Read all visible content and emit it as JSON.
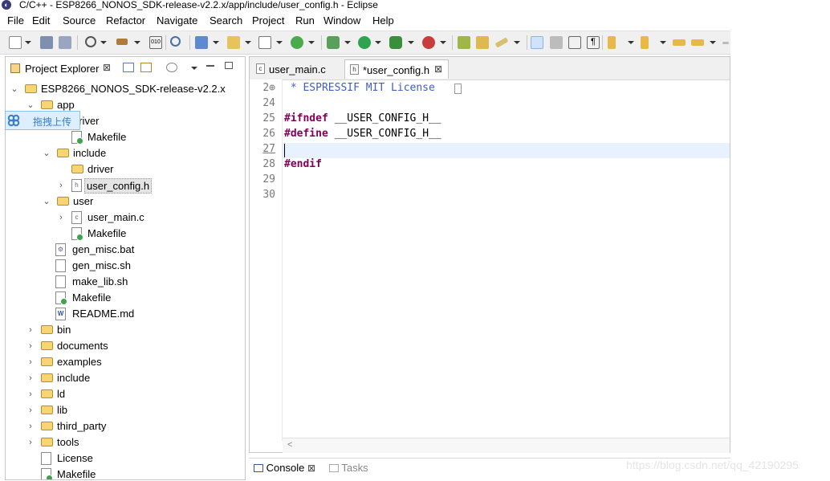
{
  "window": {
    "title": "C/C++ - ESP8266_NONOS_SDK-release-v2.2.x/app/include/user_config.h - Eclipse"
  },
  "menu": [
    "File",
    "Edit",
    "Source",
    "Refactor",
    "Navigate",
    "Search",
    "Project",
    "Run",
    "Window",
    "Help"
  ],
  "project_explorer": {
    "tab_label": "Project Explorer",
    "close_glyph": "⊠",
    "tree": [
      {
        "label": "ESP8266_NONOS_SDK-release-v2.2.x",
        "icon": "project-icon",
        "expanded": true
      },
      {
        "label": "app",
        "icon": "folder-icon",
        "expanded": true
      },
      {
        "label": "driver",
        "icon": "folder-icon",
        "expanded": true
      },
      {
        "label": "Makefile",
        "icon": "makefile-icon"
      },
      {
        "label": "include",
        "icon": "folder-icon",
        "expanded": true
      },
      {
        "label": "driver",
        "icon": "folder-icon"
      },
      {
        "label": "user_config.h",
        "icon": "header-file-icon",
        "selected": true
      },
      {
        "label": "user",
        "icon": "folder-icon",
        "expanded": true
      },
      {
        "label": "user_main.c",
        "icon": "c-file-icon"
      },
      {
        "label": "Makefile",
        "icon": "makefile-icon"
      },
      {
        "label": "gen_misc.bat",
        "icon": "bat-file-icon"
      },
      {
        "label": "gen_misc.sh",
        "icon": "text-file-icon"
      },
      {
        "label": "make_lib.sh",
        "icon": "text-file-icon"
      },
      {
        "label": "Makefile",
        "icon": "makefile-icon"
      },
      {
        "label": "README.md",
        "icon": "word-file-icon"
      },
      {
        "label": "bin",
        "icon": "folder-icon"
      },
      {
        "label": "documents",
        "icon": "folder-icon"
      },
      {
        "label": "examples",
        "icon": "folder-icon"
      },
      {
        "label": "include",
        "icon": "folder-icon"
      },
      {
        "label": "ld",
        "icon": "folder-icon"
      },
      {
        "label": "lib",
        "icon": "folder-icon"
      },
      {
        "label": "third_party",
        "icon": "folder-icon"
      },
      {
        "label": "tools",
        "icon": "folder-icon"
      },
      {
        "label": "License",
        "icon": "text-file-icon"
      },
      {
        "label": "Makefile",
        "icon": "makefile-icon"
      }
    ]
  },
  "overlay": {
    "label": "拖拽上传"
  },
  "editor": {
    "tabs": [
      {
        "label": "user_main.c",
        "icon_glyph": "c",
        "active": false
      },
      {
        "label": "*user_config.h",
        "icon_glyph": "h",
        "active": true,
        "close_glyph": "⊠"
      }
    ],
    "lines": [
      {
        "num": "2⊕",
        "text": " * ESPRESSIF MIT License"
      },
      {
        "num": "24",
        "text": ""
      },
      {
        "num": "25",
        "keyword": "#ifndef",
        "rest": " __USER_CONFIG_H__"
      },
      {
        "num": "26",
        "keyword": "#define",
        "rest": " __USER_CONFIG_H__"
      },
      {
        "num": "27",
        "text": "",
        "current": true
      },
      {
        "num": "28",
        "keyword": "#endif",
        "rest": ""
      },
      {
        "num": "29",
        "text": ""
      },
      {
        "num": "30",
        "text": ""
      }
    ],
    "scroll_glyph": "<"
  },
  "bottom_panel": {
    "tabs": [
      {
        "label": "Console",
        "active": true,
        "close_glyph": "⊠"
      },
      {
        "label": "Tasks",
        "active": false
      }
    ]
  },
  "watermark": "https://blog.csdn.net/qq_42190295",
  "colors": {
    "keyword": "#7f0055",
    "comment": "#3f5fbf",
    "current_line": "#e8f2fe"
  }
}
